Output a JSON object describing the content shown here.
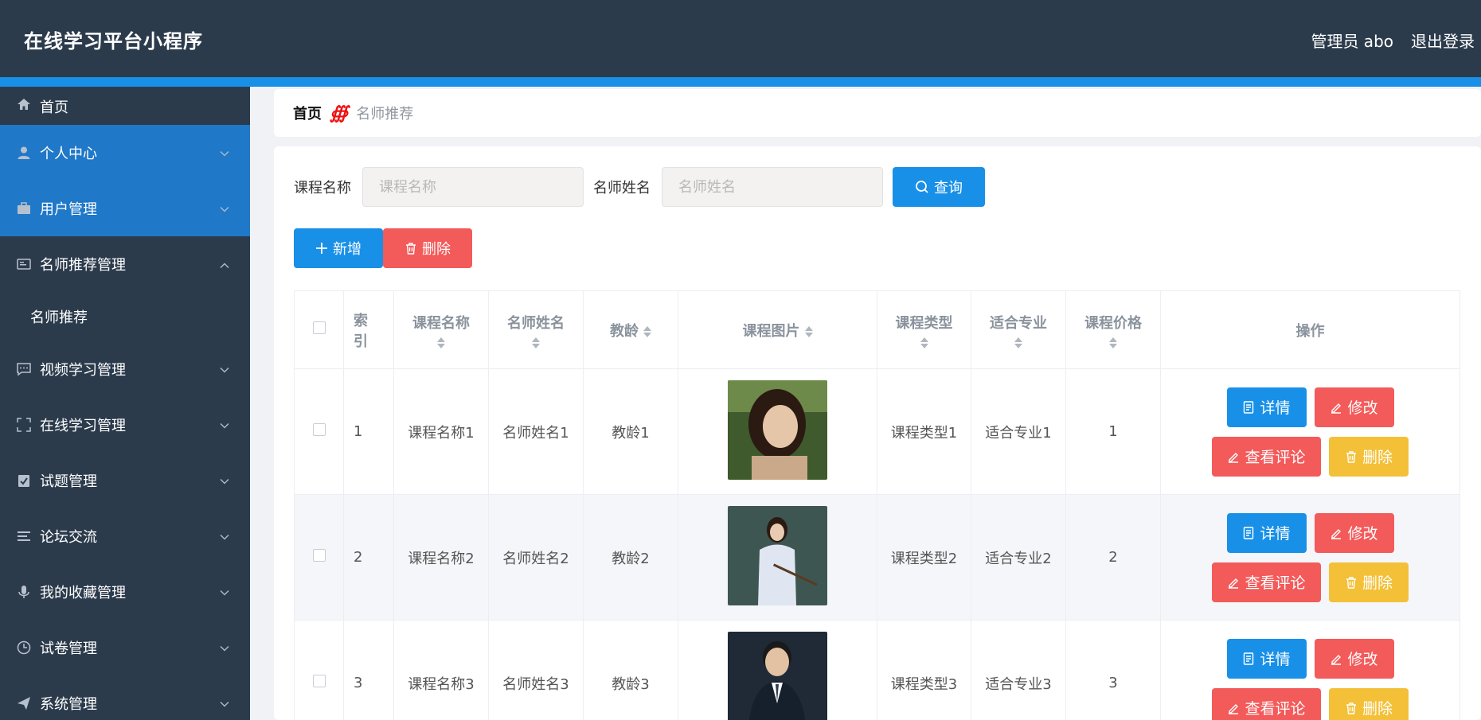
{
  "app": {
    "title": "在线学习平台小程序",
    "user": "管理员 abo",
    "logout": "退出登录"
  },
  "sidebar": {
    "home": "首页",
    "items": [
      {
        "label": "个人中心",
        "icon": "user-icon"
      },
      {
        "label": "用户管理",
        "icon": "briefcase-icon"
      },
      {
        "label": "名师推荐管理",
        "icon": "card-icon",
        "expanded": true,
        "sub": [
          "名师推荐"
        ]
      },
      {
        "label": "视频学习管理",
        "icon": "chat-icon"
      },
      {
        "label": "在线学习管理",
        "icon": "fullscreen-icon"
      },
      {
        "label": "试题管理",
        "icon": "clipboard-check-icon"
      },
      {
        "label": "论坛交流",
        "icon": "list-icon"
      },
      {
        "label": "我的收藏管理",
        "icon": "microphone-icon"
      },
      {
        "label": "试卷管理",
        "icon": "clock-icon"
      },
      {
        "label": "系统管理",
        "icon": "send-icon"
      }
    ]
  },
  "breadcrumb": {
    "home": "首页",
    "separator": "∰",
    "current": "名师推荐"
  },
  "search": {
    "course_label": "课程名称",
    "course_placeholder": "课程名称",
    "teacher_label": "名师姓名",
    "teacher_placeholder": "名师姓名",
    "query_button": "查询"
  },
  "actions": {
    "add": "新增",
    "delete": "删除"
  },
  "table": {
    "headers": [
      "索引",
      "课程名称",
      "名师姓名",
      "教龄",
      "课程图片",
      "课程类型",
      "适合专业",
      "课程价格",
      "操作"
    ],
    "header_index_line1": "索",
    "header_index_line2": "引",
    "rows": [
      {
        "index": "1",
        "course": "课程名称1",
        "teacher": "名师姓名1",
        "years": "教龄1",
        "type": "课程类型1",
        "major": "适合专业1",
        "price": "1"
      },
      {
        "index": "2",
        "course": "课程名称2",
        "teacher": "名师姓名2",
        "years": "教龄2",
        "type": "课程类型2",
        "major": "适合专业2",
        "price": "2"
      },
      {
        "index": "3",
        "course": "课程名称3",
        "teacher": "名师姓名3",
        "years": "教龄3",
        "type": "课程类型3",
        "major": "适合专业3",
        "price": "3"
      }
    ],
    "row_buttons": {
      "detail": "详情",
      "edit": "修改",
      "comments": "查看评论",
      "delete": "删除"
    }
  },
  "colors": {
    "header": "#2c3b4c",
    "accent": "#1890e8",
    "active": "#1f78c8",
    "red": "#f35a5a",
    "yellow": "#f3c038"
  }
}
